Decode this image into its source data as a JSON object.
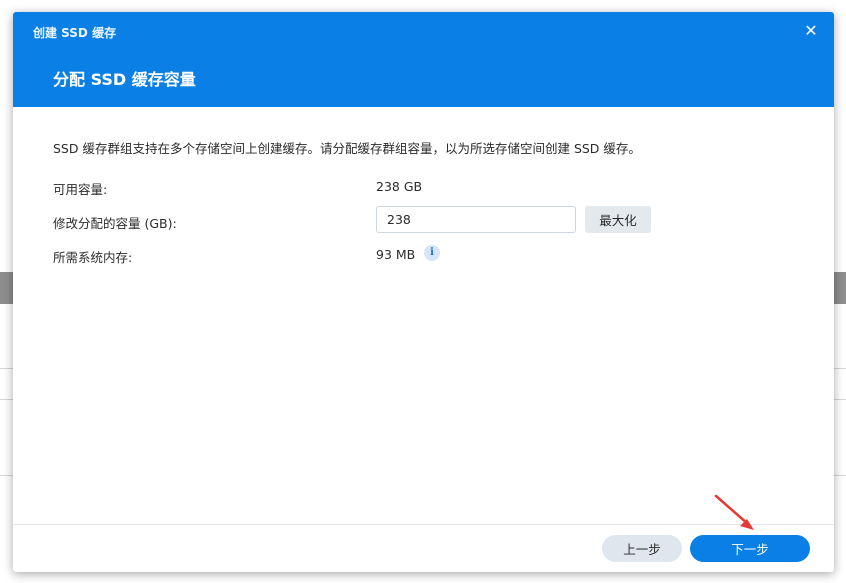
{
  "dialog": {
    "window_title": "创建 SSD 缓存",
    "close_symbol": "✕",
    "step_title": "分配 SSD 缓存容量",
    "description": "SSD 缓存群组支持在多个存储空间上创建缓存。请分配缓存群组容量，以为所选存储空间创建 SSD 缓存。",
    "available_capacity": {
      "label": "可用容量:",
      "value": "238 GB"
    },
    "allocated_capacity": {
      "label": "修改分配的容量 (GB):",
      "value": "238",
      "max_button": "最大化"
    },
    "system_memory": {
      "label": "所需系统内存:",
      "value": "93 MB",
      "info_icon": "info-icon"
    },
    "footer": {
      "prev_button": "上一步",
      "next_button": "下一步"
    }
  },
  "colors": {
    "header": "#0a7fe6",
    "primary_button": "#0a7fe6",
    "secondary_button": "#dfe6ed",
    "annotation_arrow": "#e53935"
  }
}
